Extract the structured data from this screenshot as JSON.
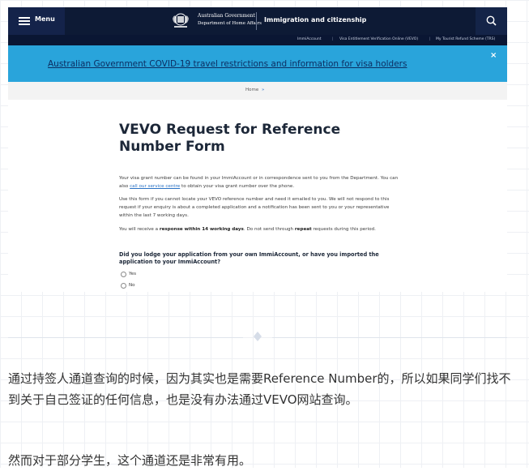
{
  "header": {
    "menu_label": "Menu",
    "gov_line1": "Australian Government",
    "gov_line2": "Department of Home Affairs",
    "title": "Immigration and citizenship"
  },
  "subnav": [
    "ImmiAccount",
    "|",
    "Visa Entitlement Verification Online (VEVO)",
    "|",
    "My Tourist Refund Scheme (TRS)"
  ],
  "banner": {
    "link_text": "Australian Government COVID-19 travel restrictions and information for visa holders",
    "close": "×"
  },
  "breadcrumb": {
    "home": "Home",
    "sep": "»"
  },
  "form": {
    "title": "VEVO Request for Reference Number Form",
    "para1_a": "Your visa grant number can be found in your ImmiAccount or in correspondence sent to you from the Department. You can also ",
    "para1_link": "call our service centre",
    "para1_b": " to obtain your visa grant number over the phone.",
    "para2": "Use this form if you cannot locate your VEVO reference number and need it emailed to you. We will not respond to this request if your enquiry is about a completed application and a notification has been sent to you or your representative within the last 7 working days.",
    "para3_a": "You will receive a ",
    "para3_b": "response within 14 working days",
    "para3_c": ". Do not send through ",
    "para3_d": "repeat",
    "para3_e": " requests during this period.",
    "question": "Did you lodge your application from your own ImmiAccount, or have you imported the application to your ImmiAccount?",
    "options": [
      "Yes",
      "No"
    ]
  },
  "article": {
    "para1": "通过持签人通道查询的时候，因为其实也是需要Reference Number的，所以如果同学们找不到关于自己签证的任何信息，也是没有办法通过VEVO网站查询。",
    "para2": "然而对于部分学生，这个通道还是非常有用。"
  }
}
